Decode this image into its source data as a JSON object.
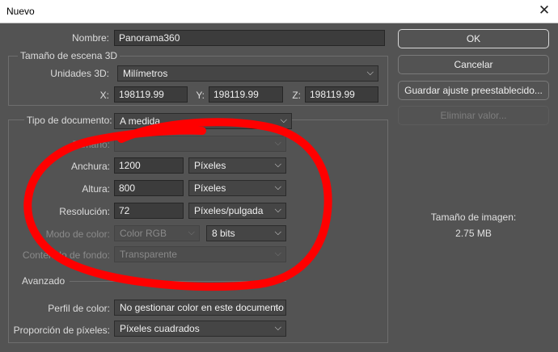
{
  "window": {
    "title": "Nuevo",
    "close_glyph": "✕"
  },
  "form": {
    "name_label": "Nombre:",
    "name_value": "Panorama360",
    "scene_group": "Tamaño de escena 3D",
    "units_label": "Unidades 3D:",
    "units_value": "Milímetros",
    "x_label": "X:",
    "x_value": "198119.99",
    "y_label": "Y:",
    "y_value": "198119.99",
    "z_label": "Z:",
    "z_value": "198119.99",
    "doctype_label": "Tipo de documento:",
    "doctype_value": "A medida",
    "size_label": "Tamaño:",
    "size_value": "",
    "width_label": "Anchura:",
    "width_value": "1200",
    "width_unit": "Píxeles",
    "height_label": "Altura:",
    "height_value": "800",
    "height_unit": "Píxeles",
    "res_label": "Resolución:",
    "res_value": "72",
    "res_unit": "Píxeles/pulgada",
    "colormode_label": "Modo de color:",
    "colormode_value": "Color RGB",
    "bits_value": "8 bits",
    "bg_label": "Contenido de fondo:",
    "bg_value": "Transparente",
    "advanced_label": "Avanzado",
    "profile_label": "Perfil de color:",
    "profile_value": "No gestionar color en este documento",
    "pixel_label": "Proporción de píxeles:",
    "pixel_value": "Píxeles cuadrados"
  },
  "buttons": {
    "ok": "OK",
    "cancel": "Cancelar",
    "save_preset": "Guardar ajuste preestablecido...",
    "delete_preset": "Eliminar valor..."
  },
  "image_size": {
    "label": "Tamaño de imagen:",
    "value": "2.75 MB"
  },
  "icons": {
    "dropdown": "chevron-down-icon",
    "close": "close-icon"
  },
  "colors": {
    "background": "#535353",
    "field": "#3c3c3c",
    "annotation": "#ff0000"
  }
}
